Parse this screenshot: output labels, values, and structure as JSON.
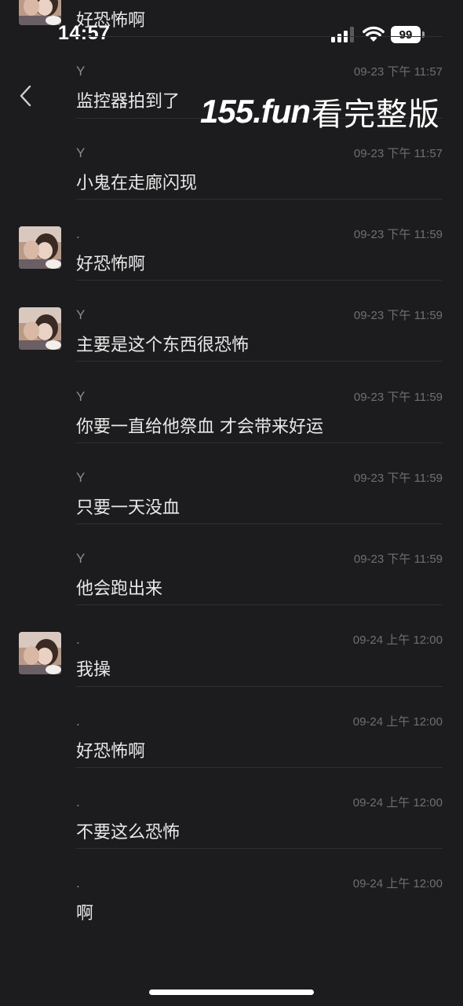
{
  "status_bar": {
    "time": "14:57",
    "battery": "99",
    "signal_icon": "cellular-signal-icon",
    "wifi_icon": "wifi-icon"
  },
  "watermark": {
    "site": "155.fun",
    "text": "看完整版"
  },
  "back_icon": "chevron-left-icon",
  "messages": [
    {
      "sender": "",
      "time": "",
      "text": "好恐怖啊",
      "avatar": true
    },
    {
      "sender": "Y",
      "time": "09-23 下午 11:57",
      "text": "监控器拍到了",
      "avatar": false
    },
    {
      "sender": "Y",
      "time": "09-23 下午 11:57",
      "text": "小鬼在走廊闪现",
      "avatar": false
    },
    {
      "sender": ".",
      "time": "09-23 下午 11:59",
      "text": "好恐怖啊",
      "avatar": true
    },
    {
      "sender": "Y",
      "time": "09-23 下午 11:59",
      "text": "主要是这个东西很恐怖",
      "avatar": true
    },
    {
      "sender": "Y",
      "time": "09-23 下午 11:59",
      "text": "你要一直给他祭血 才会带来好运",
      "avatar": false
    },
    {
      "sender": "Y",
      "time": "09-23 下午 11:59",
      "text": "只要一天没血",
      "avatar": false
    },
    {
      "sender": "Y",
      "time": "09-23 下午 11:59",
      "text": "他会跑出来",
      "avatar": false
    },
    {
      "sender": ".",
      "time": "09-24 上午 12:00",
      "text": "我操",
      "avatar": true
    },
    {
      "sender": ".",
      "time": "09-24 上午 12:00",
      "text": "好恐怖啊",
      "avatar": false
    },
    {
      "sender": ".",
      "time": "09-24 上午 12:00",
      "text": "不要这么恐怖",
      "avatar": false
    },
    {
      "sender": ".",
      "time": "09-24 上午 12:00",
      "text": "啊",
      "avatar": false
    }
  ]
}
